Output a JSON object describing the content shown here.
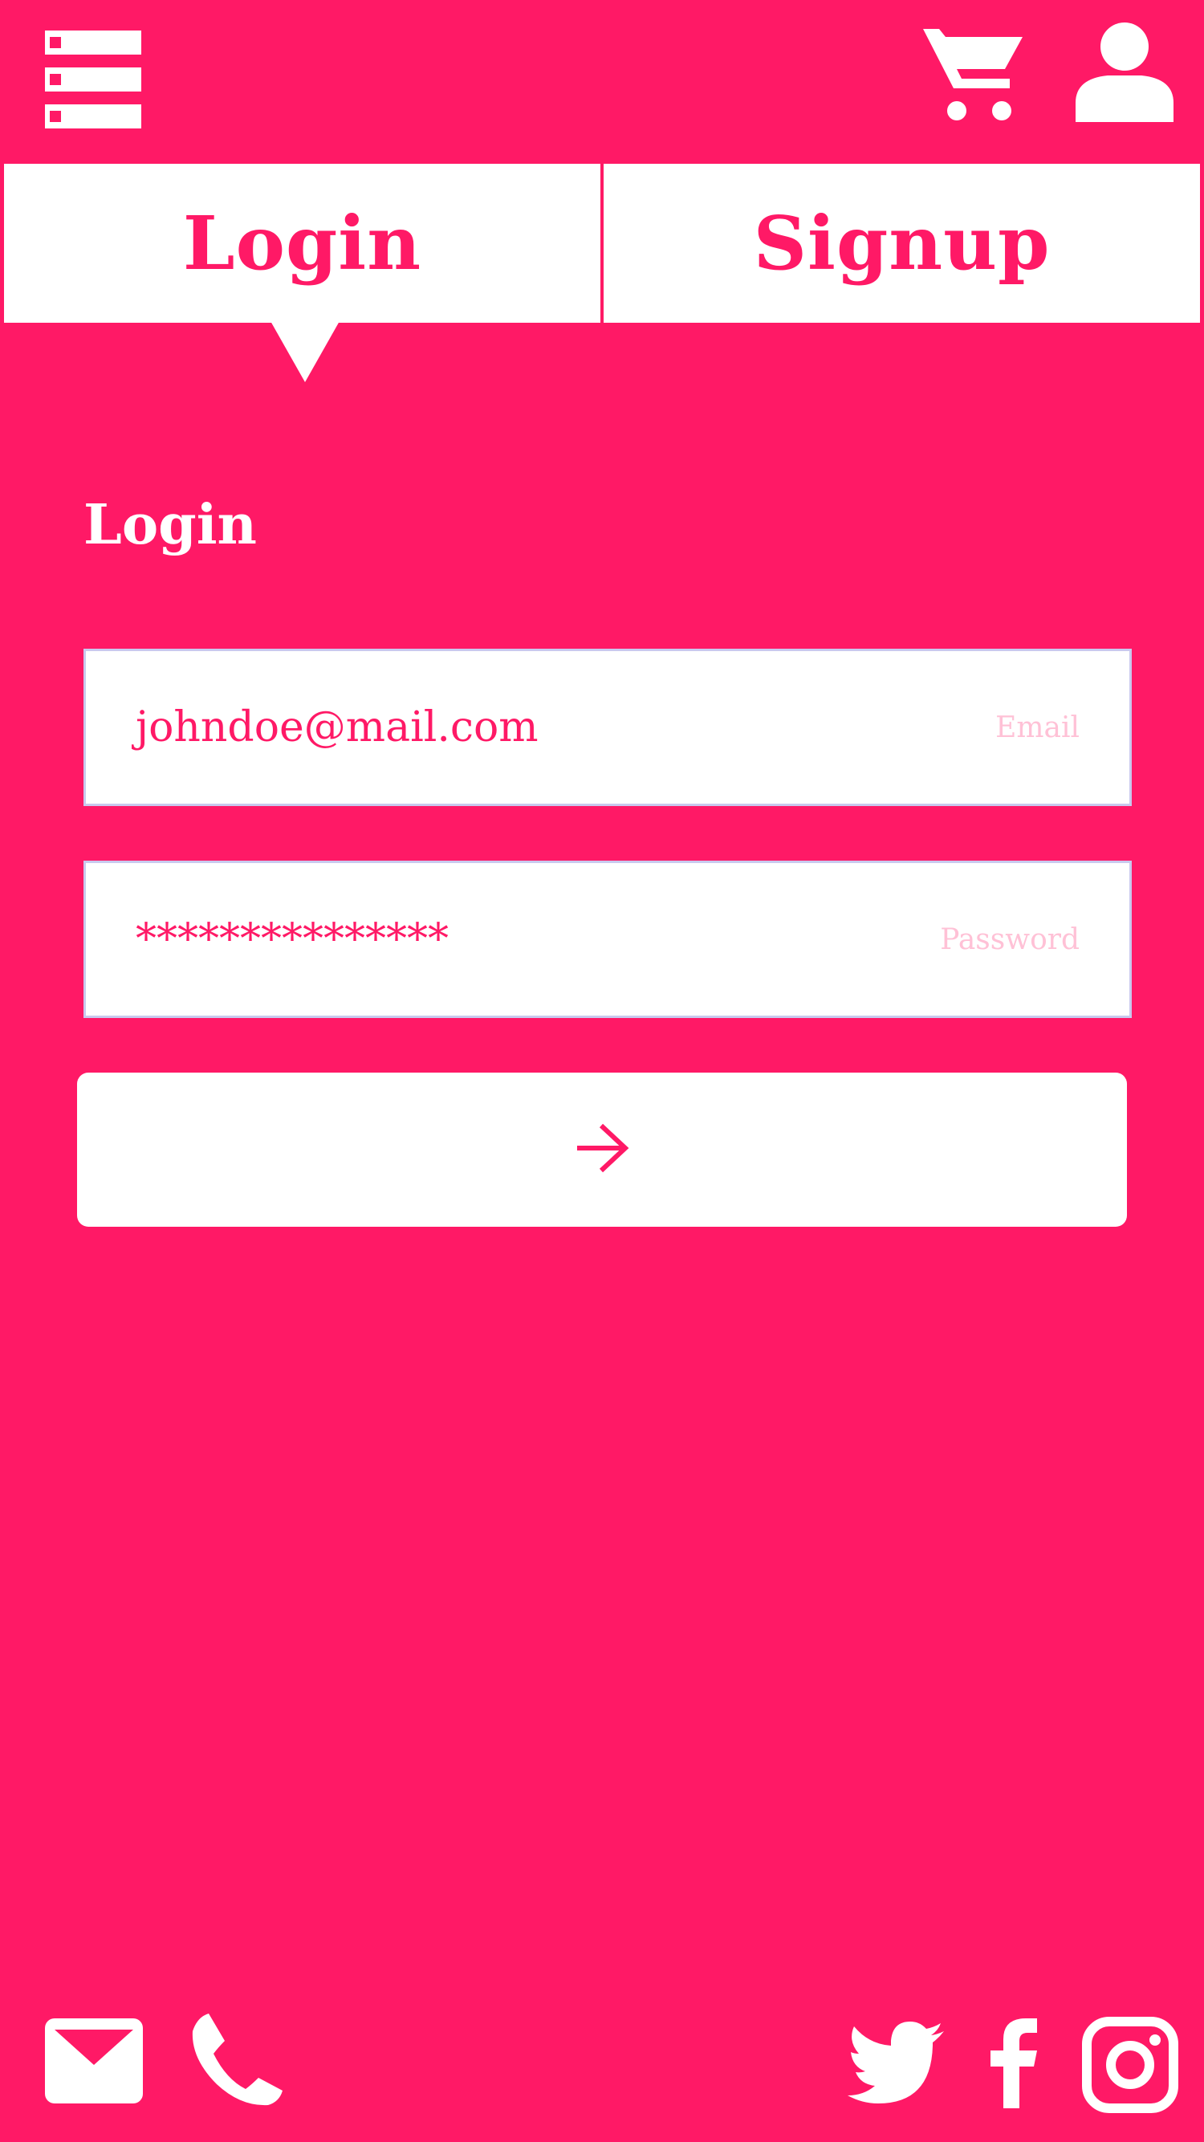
{
  "theme": {
    "accent": "#ff1966",
    "surface": "#ffffff",
    "field_border": "#c9c9ee",
    "hint_text": "#ffc1d6"
  },
  "header": {
    "icons": [
      "menu-icon",
      "cart-icon",
      "user-icon"
    ]
  },
  "tabs": [
    {
      "label": "Login",
      "active": true
    },
    {
      "label": "Signup",
      "active": false
    }
  ],
  "form": {
    "heading": "Login",
    "email": {
      "value": "johndoe@mail.com",
      "label": "Email"
    },
    "password": {
      "value": "***************",
      "label": "Password"
    },
    "submit_icon": "arrow-right-icon"
  },
  "footer": {
    "contact_icons": [
      "mail-icon",
      "phone-icon"
    ],
    "social_icons": [
      "twitter-icon",
      "facebook-icon",
      "instagram-icon"
    ]
  }
}
